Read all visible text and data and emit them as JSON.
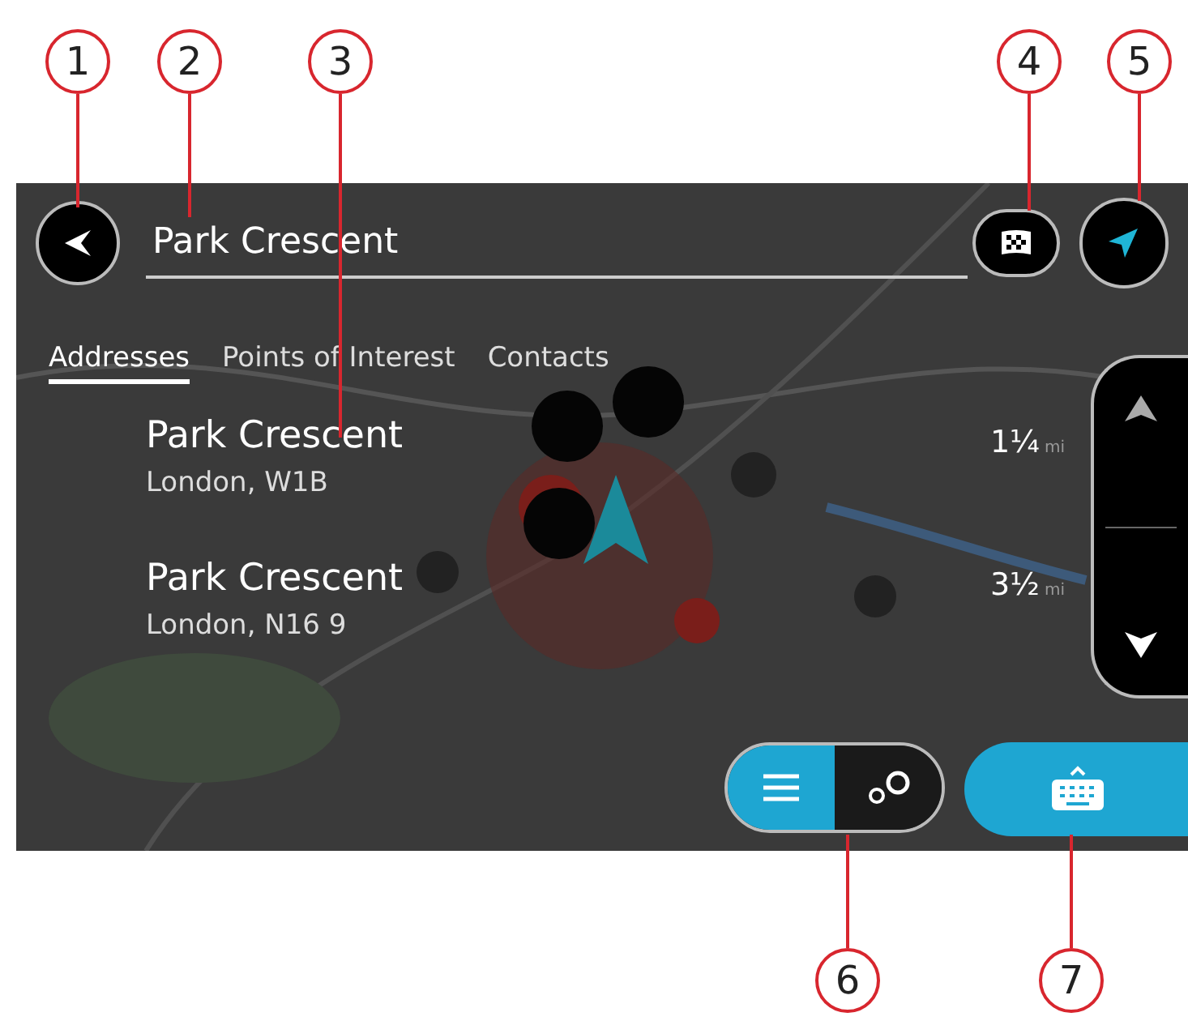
{
  "callouts": [
    {
      "label": "1"
    },
    {
      "label": "2"
    },
    {
      "label": "3"
    },
    {
      "label": "4"
    },
    {
      "label": "5"
    },
    {
      "label": "6"
    },
    {
      "label": "7"
    }
  ],
  "search": {
    "value": "Park Crescent"
  },
  "tabs": [
    {
      "label": "Addresses",
      "selected": true
    },
    {
      "label": "Points of Interest",
      "selected": false
    },
    {
      "label": "Contacts",
      "selected": false
    }
  ],
  "results": [
    {
      "name": "Park Crescent",
      "address": "London, W1B",
      "distance": "1¼",
      "unit": "mi"
    },
    {
      "name": "Park Crescent",
      "address": "London, N16 9",
      "distance": "3½",
      "unit": "mi"
    }
  ],
  "view_toggle": [
    {
      "kind": "list",
      "selected": true
    },
    {
      "kind": "map",
      "selected": false
    }
  ]
}
